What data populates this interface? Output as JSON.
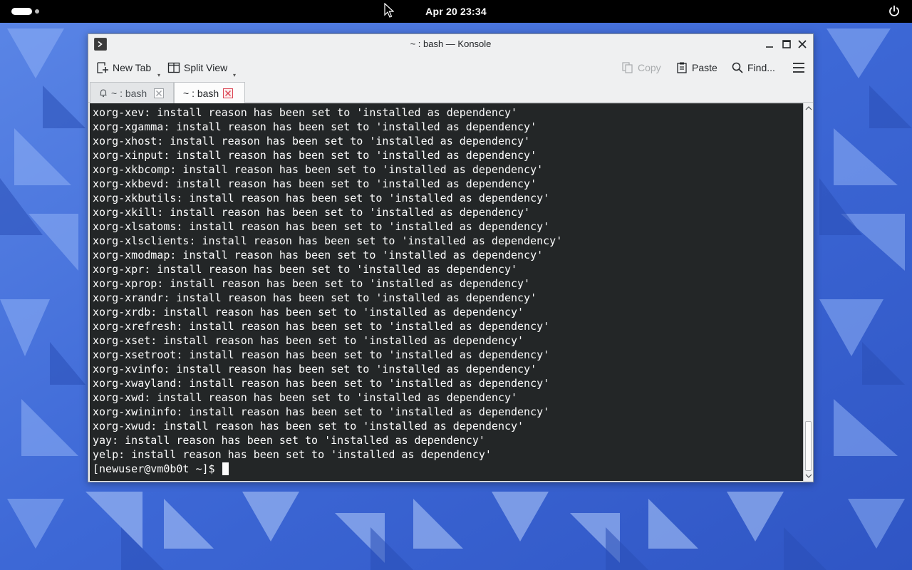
{
  "topbar": {
    "clock": "Apr 20  23:34"
  },
  "window": {
    "title": "~ : bash — Konsole"
  },
  "toolbar": {
    "new_tab": "New Tab",
    "split_view": "Split View",
    "copy": "Copy",
    "paste": "Paste",
    "find": "Find..."
  },
  "tabs": [
    {
      "label": "~ : bash",
      "active": false
    },
    {
      "label": "~ : bash",
      "active": true
    }
  ],
  "terminal": {
    "lines": [
      "xorg-xev: install reason has been set to 'installed as dependency'",
      "xorg-xgamma: install reason has been set to 'installed as dependency'",
      "xorg-xhost: install reason has been set to 'installed as dependency'",
      "xorg-xinput: install reason has been set to 'installed as dependency'",
      "xorg-xkbcomp: install reason has been set to 'installed as dependency'",
      "xorg-xkbevd: install reason has been set to 'installed as dependency'",
      "xorg-xkbutils: install reason has been set to 'installed as dependency'",
      "xorg-xkill: install reason has been set to 'installed as dependency'",
      "xorg-xlsatoms: install reason has been set to 'installed as dependency'",
      "xorg-xlsclients: install reason has been set to 'installed as dependency'",
      "xorg-xmodmap: install reason has been set to 'installed as dependency'",
      "xorg-xpr: install reason has been set to 'installed as dependency'",
      "xorg-xprop: install reason has been set to 'installed as dependency'",
      "xorg-xrandr: install reason has been set to 'installed as dependency'",
      "xorg-xrdb: install reason has been set to 'installed as dependency'",
      "xorg-xrefresh: install reason has been set to 'installed as dependency'",
      "xorg-xset: install reason has been set to 'installed as dependency'",
      "xorg-xsetroot: install reason has been set to 'installed as dependency'",
      "xorg-xvinfo: install reason has been set to 'installed as dependency'",
      "xorg-xwayland: install reason has been set to 'installed as dependency'",
      "xorg-xwd: install reason has been set to 'installed as dependency'",
      "xorg-xwininfo: install reason has been set to 'installed as dependency'",
      "xorg-xwud: install reason has been set to 'installed as dependency'",
      "yay: install reason has been set to 'installed as dependency'",
      "yelp: install reason has been set to 'installed as dependency'"
    ],
    "prompt": "[newuser@vm0b0t ~]$ "
  },
  "colors": {
    "terminal_bg": "#232627",
    "terminal_fg": "#fcfcfc",
    "wallpaper_base": "#3f6ed8",
    "topbar": "#000000",
    "tab_close_active": "#da4453"
  }
}
